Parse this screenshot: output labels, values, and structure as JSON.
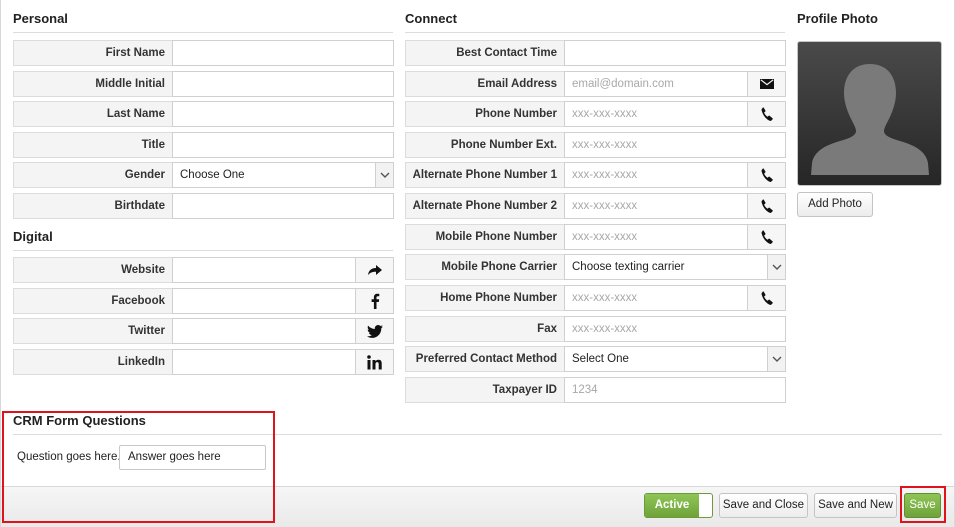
{
  "sections": {
    "personal": "Personal",
    "digital": "Digital",
    "connect": "Connect",
    "profile_photo": "Profile Photo",
    "crm": "CRM Form Questions"
  },
  "personal": {
    "first_name": {
      "label": "First Name",
      "value": ""
    },
    "middle_initial": {
      "label": "Middle Initial",
      "value": ""
    },
    "last_name": {
      "label": "Last Name",
      "value": ""
    },
    "title": {
      "label": "Title",
      "value": ""
    },
    "gender": {
      "label": "Gender",
      "value": "Choose One"
    },
    "birthdate": {
      "label": "Birthdate",
      "value": ""
    }
  },
  "digital": {
    "website": {
      "label": "Website",
      "icon": "share-arrow-icon"
    },
    "facebook": {
      "label": "Facebook",
      "icon": "facebook-icon"
    },
    "twitter": {
      "label": "Twitter",
      "icon": "twitter-icon"
    },
    "linkedin": {
      "label": "LinkedIn",
      "icon": "linkedin-icon"
    }
  },
  "connect": {
    "best_contact_time": {
      "label": "Best Contact Time",
      "placeholder": ""
    },
    "email": {
      "label": "Email Address",
      "placeholder": "email@domain.com"
    },
    "phone": {
      "label": "Phone Number",
      "placeholder": "xxx-xxx-xxxx"
    },
    "phone_ext": {
      "label": "Phone Number Ext.",
      "placeholder": "xxx-xxx-xxxx"
    },
    "alt_phone_1": {
      "label": "Alternate Phone Number 1",
      "placeholder": "xxx-xxx-xxxx"
    },
    "alt_phone_2": {
      "label": "Alternate Phone Number 2",
      "placeholder": "xxx-xxx-xxxx"
    },
    "mobile_phone": {
      "label": "Mobile Phone Number",
      "placeholder": "xxx-xxx-xxxx"
    },
    "mobile_carrier": {
      "label": "Mobile Phone Carrier",
      "value": "Choose texting carrier"
    },
    "home_phone": {
      "label": "Home Phone Number",
      "placeholder": "xxx-xxx-xxxx"
    },
    "fax": {
      "label": "Fax",
      "placeholder": "xxx-xxx-xxxx"
    },
    "preferred_contact": {
      "label": "Preferred Contact Method",
      "value": "Select One"
    },
    "taxpayer_id": {
      "label": "Taxpayer ID",
      "placeholder": "1234"
    }
  },
  "photo": {
    "add_label": "Add Photo"
  },
  "crm": {
    "question": "Question goes here.",
    "answer": "Answer goes here"
  },
  "footer": {
    "active_label": "Active",
    "save_close_label": "Save and Close",
    "save_new_label": "Save and New",
    "save_label": "Save"
  },
  "colors": {
    "accent_green": "#7cb342",
    "highlight_red": "#e0121b"
  }
}
